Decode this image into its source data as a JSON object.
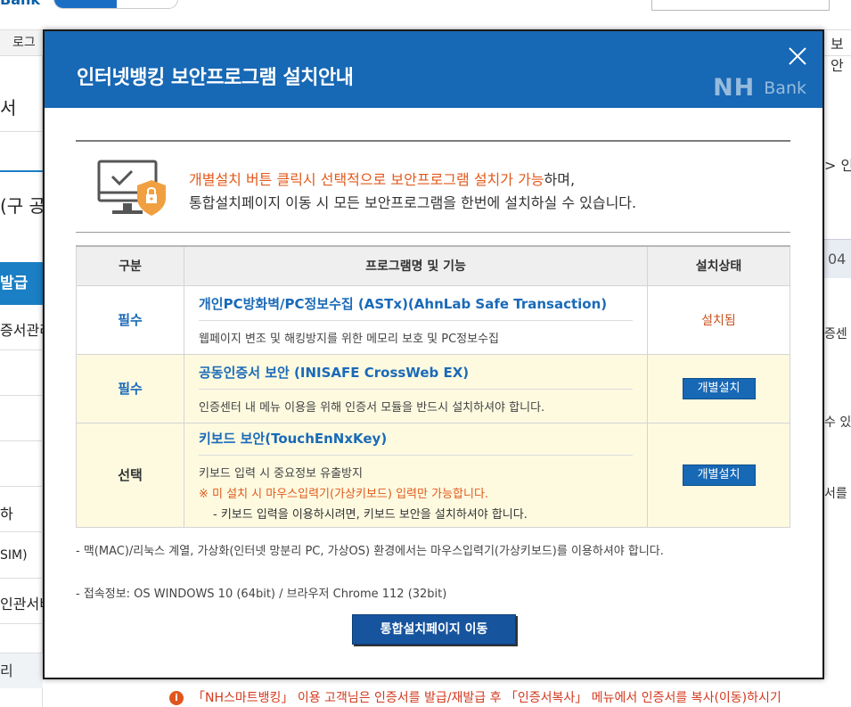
{
  "background": {
    "logo_text": "Bank",
    "nav_login": "로그",
    "right_tab": "보안",
    "side_items": [
      "서",
      "(구 공",
      "발급",
      "증서관리",
      "",
      "",
      "",
      "하",
      "SIM)",
      "인관서비",
      "리"
    ],
    "right_texts": [
      "> 인",
      "04",
      "증센",
      "수 있",
      "서를 시"
    ],
    "notice_icon": "i",
    "notice_text": "「NH스마트뱅킹」 이용 고객님은 인증서를 발급/재발급 후 「인증서복사」 메뉴에서 인증서를 복사(이동)하시기"
  },
  "modal": {
    "title": "인터넷뱅킹 보안프로그램 설치안내",
    "brand_nh": "NH",
    "brand_bank": "Bank",
    "intro_highlight": "개별설치 버튼 클릭시 선택적으로 보안프로그램 설치가 가능",
    "intro_rest1": "하며,",
    "intro_line2": "통합설치페이지 이동 시 모든 보안프로그램을 한번에 설치하실 수 있습니다.",
    "table": {
      "headers": [
        "구분",
        "프로그램명 및 기능",
        "설치상태"
      ],
      "rows": [
        {
          "category": "필수",
          "name": "개인PC방화벽/PC정보수집 (ASTx)(AhnLab Safe Transaction)",
          "desc": "웹페이지 변조 및 해킹방지를 위한 메모리 보호 및 PC정보수집",
          "status": "설치됨"
        },
        {
          "category": "필수",
          "name": "공동인증서 보안 (INISAFE CrossWeb EX)",
          "desc": "인증센터 내 메뉴 이용을 위해 인증서 모듈을 반드시 설치하셔야 합니다.",
          "button": "개별설치"
        },
        {
          "category": "선택",
          "name": "키보드 보안(TouchEnNxKey)",
          "desc": "키보드 입력 시 중요정보 유출방지",
          "warn": "※ 미 설치 시 마우스입력기(가상키보드) 입력만 가능합니다.",
          "sub": "- 키보드 입력을 이용하시려면, 키보드 보안을 설치하셔야 합니다.",
          "button": "개별설치"
        }
      ]
    },
    "note1": "- 맥(MAC)/리눅스 계열, 가상화(인터넷 망분리 PC, 가상OS) 환경에서는 마우스입력기(가상키보드)를 이용하셔야 합니다.",
    "note2": "- 접속정보: OS WINDOWS 10 (64bit) / 브라우저 Chrome 112 (32bit)",
    "integrated_button": "통합설치페이지 이동"
  },
  "colors": {
    "header_blue": "#1768b5",
    "highlight_orange": "#e25a1c",
    "name_blue": "#1a6ab8",
    "row_yellow": "#fdfae0"
  }
}
